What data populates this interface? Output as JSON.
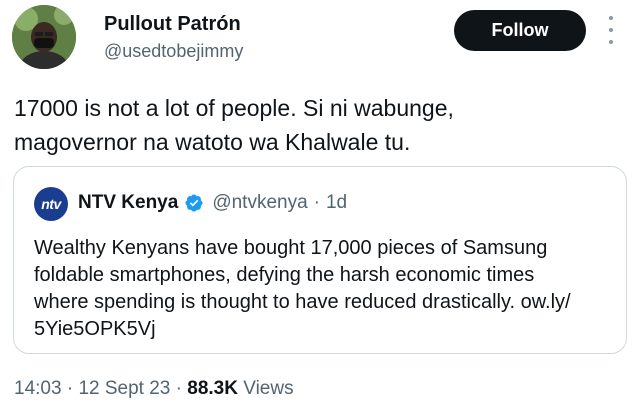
{
  "author": {
    "name": "Pullout Patrón",
    "handle": "@usedtobejimmy"
  },
  "follow_button": {
    "label": "Follow"
  },
  "tweet": {
    "lines": [
      "17000 is not a lot of people.  Si ni wabunge,",
      "magovernor na watoto wa Khalwale tu."
    ]
  },
  "quote": {
    "avatar_text": "ntv",
    "name": "NTV Kenya",
    "handle": "@ntvkenya",
    "separator": "·",
    "time": "1d",
    "lines": [
      "Wealthy Kenyans have bought 17,000 pieces of Samsung",
      "foldable smartphones, defying the harsh economic times",
      "where spending is thought to have reduced drastically. ow.ly/",
      "5Yie5OPK5Vj"
    ]
  },
  "meta": {
    "time": "14:03",
    "separator": "·",
    "date": "12 Sept 23",
    "views_count": "88.3K",
    "views_label": "Views"
  },
  "colors": {
    "text_primary": "#0f1419",
    "text_secondary": "#536471",
    "follow_bg": "#0f1419",
    "verified": "#1d9bf0",
    "card_border": "#cfd9de"
  },
  "icons": {
    "more": "more-vertical-icon",
    "verified": "verified-badge-icon"
  }
}
